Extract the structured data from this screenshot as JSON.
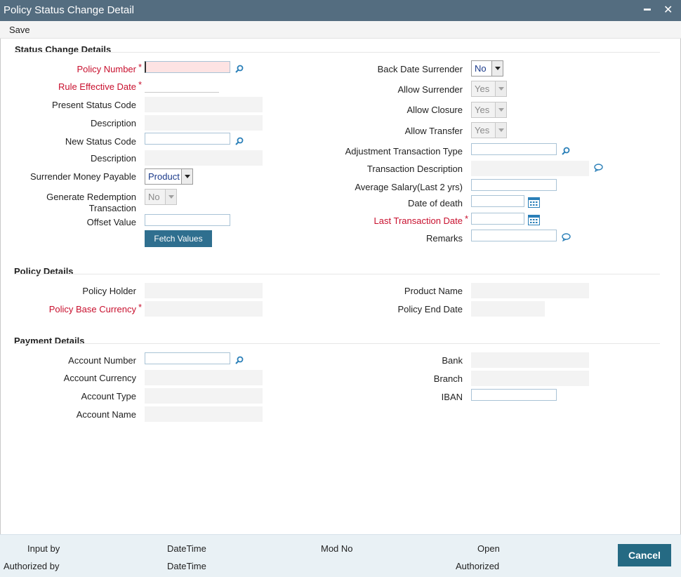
{
  "window": {
    "title": "Policy Status Change Detail",
    "minimize_glyph": "━",
    "close_glyph": "✕"
  },
  "toolbar": {
    "save_label": "Save"
  },
  "sections": {
    "status_change": "Status Change Details",
    "policy_details": "Policy Details",
    "payment_details": "Payment Details"
  },
  "status_left": {
    "policy_number": "Policy Number",
    "rule_effective_date": "Rule Effective Date",
    "present_status_code": "Present Status Code",
    "description1": "Description",
    "new_status_code": "New Status Code",
    "description2": "Description",
    "surrender_money_payable": "Surrender Money Payable",
    "surrender_money_payable_value": "Product",
    "generate_redemption": "Generate Redemption Transaction",
    "generate_redemption_value": "No",
    "offset_value": "Offset Value",
    "fetch_values": "Fetch Values"
  },
  "status_right": {
    "back_date_surrender": "Back Date Surrender",
    "back_date_surrender_value": "No",
    "allow_surrender": "Allow Surrender",
    "allow_surrender_value": "Yes",
    "allow_closure": "Allow Closure",
    "allow_closure_value": "Yes",
    "allow_transfer": "Allow Transfer",
    "allow_transfer_value": "Yes",
    "adjustment_transaction_type": "Adjustment Transaction Type",
    "transaction_description": "Transaction Description",
    "average_salary": "Average Salary(Last 2 yrs)",
    "date_of_death": "Date of death",
    "last_transaction_date": "Last Transaction Date",
    "remarks": "Remarks"
  },
  "policy": {
    "policy_holder": "Policy Holder",
    "policy_base_currency": "Policy Base Currency",
    "product_name": "Product Name",
    "policy_end_date": "Policy End Date"
  },
  "payment": {
    "account_number": "Account Number",
    "account_currency": "Account Currency",
    "account_type": "Account Type",
    "account_name": "Account Name",
    "bank": "Bank",
    "branch": "Branch",
    "iban": "IBAN"
  },
  "required_mark": "*",
  "footer": {
    "input_by": "Input by",
    "authorized_by": "Authorized by",
    "datetime1": "DateTime",
    "datetime2": "DateTime",
    "mod_no": "Mod No",
    "open": "Open",
    "authorized": "Authorized",
    "cancel": "Cancel"
  },
  "icons": {
    "lov": "search-icon",
    "calendar": "calendar-icon",
    "remarks": "speech-bubble-icon"
  },
  "colors": {
    "titlebar": "#546d80",
    "required": "#c8102e",
    "button": "#2f6f8f",
    "footer_bg": "#e9f1f5"
  }
}
